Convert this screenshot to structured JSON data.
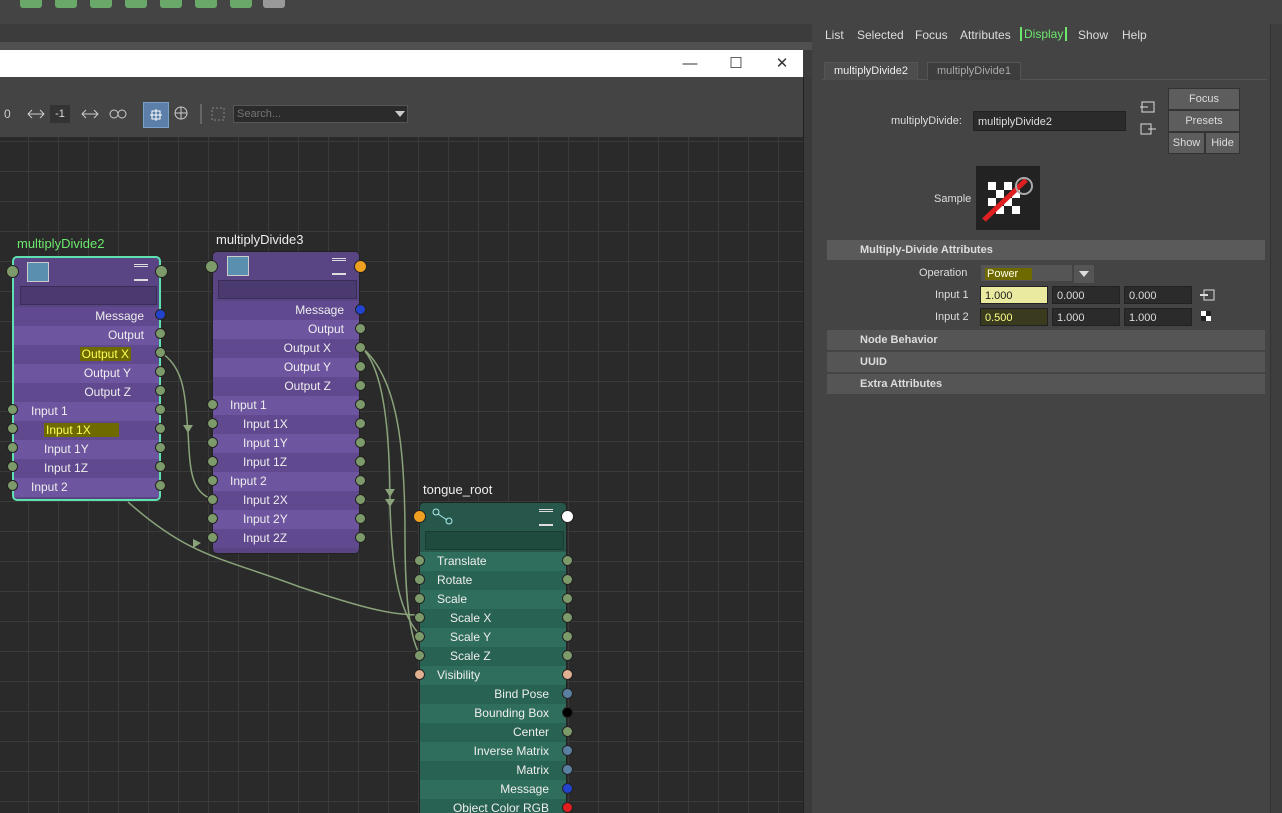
{
  "right_panel": {
    "menu": [
      "List",
      "Selected",
      "Focus",
      "Attributes",
      "Display",
      "Show",
      "Help"
    ],
    "tabs": [
      "multiplyDivide2",
      "multiplyDivide1"
    ],
    "node_label": "multiplyDivide:",
    "node_value": "multiplyDivide2",
    "focus": "Focus",
    "presets": "Presets",
    "show": "Show",
    "hide": "Hide",
    "sample_label": "Sample",
    "section_main": "Multiply-Divide Attributes",
    "operation_label": "Operation",
    "operation_value": "Power",
    "input1_label": "Input 1",
    "input1_values": [
      "1.000",
      "0.000",
      "0.000"
    ],
    "input2_label": "Input 2",
    "input2_values": [
      "0.500",
      "1.000",
      "1.000"
    ],
    "sections": [
      "Node Behavior",
      "UUID",
      "Extra Attributes"
    ]
  },
  "window": {
    "minimize": "—",
    "maximize": "☐",
    "close": "✕"
  },
  "toolbar": {
    "zoom_value": "0",
    "frame_value": "-1",
    "search_placeholder": "Search..."
  },
  "nodes": {
    "md2": {
      "title": "multiplyDivide2",
      "rows": [
        "Message",
        "Output",
        "Output X",
        "Output Y",
        "Output Z",
        "Input 1",
        "Input 1X",
        "Input 1Y",
        "Input 1Z",
        "Input 2"
      ]
    },
    "md3": {
      "title": "multiplyDivide3",
      "rows": [
        "Message",
        "Output",
        "Output X",
        "Output Y",
        "Output Z",
        "Input 1",
        "Input 1X",
        "Input 1Y",
        "Input 1Z",
        "Input 2",
        "Input 2X",
        "Input 2Y",
        "Input 2Z"
      ]
    },
    "tongue": {
      "title": "tongue_root",
      "rows": [
        "Translate",
        "Rotate",
        "Scale",
        "Scale X",
        "Scale Y",
        "Scale Z",
        "Visibility",
        "Bind Pose",
        "Bounding Box",
        "Center",
        "Inverse Matrix",
        "Matrix",
        "Message",
        "Object Color RGB"
      ]
    }
  },
  "colors": {
    "highlight": "#e6e600",
    "selected_node_border": "#5fe0b0",
    "display_accent": "#6ce86c"
  }
}
